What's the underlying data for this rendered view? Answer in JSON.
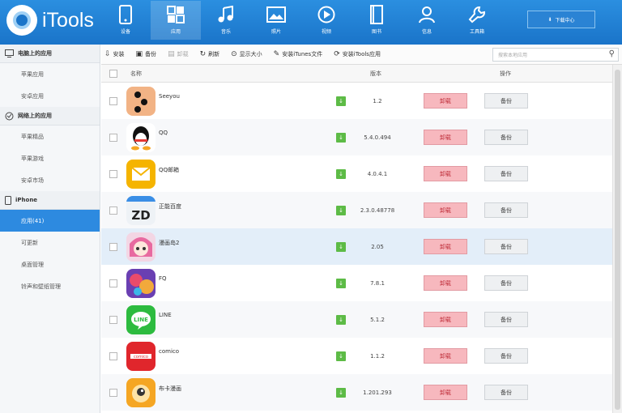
{
  "app": {
    "logo_text": "iTools",
    "brand_color": "#1a74c9"
  },
  "nav": [
    {
      "label": "设备",
      "icon": "device-icon"
    },
    {
      "label": "应用",
      "icon": "apps-icon"
    },
    {
      "label": "音乐",
      "icon": "music-icon"
    },
    {
      "label": "照片",
      "icon": "photo-icon"
    },
    {
      "label": "视频",
      "icon": "video-icon"
    },
    {
      "label": "图书",
      "icon": "book-icon"
    },
    {
      "label": "信息",
      "icon": "contacts-icon"
    },
    {
      "label": "工具箱",
      "icon": "toolbox-icon"
    }
  ],
  "download_center": "下载中心",
  "sidebar": {
    "sections": [
      {
        "title": "电脑上的应用",
        "icon": "monitor-icon",
        "items": [
          "苹果应用",
          "安卓应用"
        ]
      },
      {
        "title": "网络上的应用",
        "icon": "globe-icon",
        "items": [
          "苹果精品",
          "苹果游戏",
          "安卓市场"
        ]
      },
      {
        "title": "iPhone",
        "icon": "phone-icon",
        "items": [
          "应用(41)",
          "可更新",
          "桌面管理",
          "铃声和壁纸管理"
        ]
      }
    ]
  },
  "toolbar": {
    "items": [
      {
        "label": "安装",
        "icon": "install-icon",
        "disabled": false
      },
      {
        "label": "备份",
        "icon": "backup-icon",
        "disabled": false
      },
      {
        "label": "卸载",
        "icon": "uninstall-icon",
        "disabled": true
      },
      {
        "label": "刷新",
        "icon": "refresh-icon",
        "disabled": false
      },
      {
        "label": "显示大小",
        "icon": "size-icon",
        "disabled": false
      },
      {
        "label": "安装iTunes文件",
        "icon": "itunes-file-icon",
        "disabled": false
      },
      {
        "label": "安装iTools应用",
        "icon": "itools-app-icon",
        "disabled": false
      }
    ],
    "search_placeholder": "搜索本地应用"
  },
  "table": {
    "headers": {
      "name": "名称",
      "version": "版本",
      "action": "操作"
    },
    "uninstall_label": "卸载",
    "backup_label": "备份",
    "rows": [
      {
        "name": "Seeyou",
        "version": "1.2",
        "icon": "seeyou-app-icon"
      },
      {
        "name": "QQ",
        "version": "5.4.0.494",
        "icon": "qq-app-icon"
      },
      {
        "name": "QQ邮箱",
        "version": "4.0.4.1",
        "icon": "qq-mail-app-icon"
      },
      {
        "name": "正能百度",
        "version": "2.3.0.48778",
        "icon": "zd-app-icon"
      },
      {
        "name": "漫画岛2",
        "version": "2.05",
        "icon": "manga-app-icon"
      },
      {
        "name": "FQ",
        "version": "7.8.1",
        "icon": "fq-app-icon"
      },
      {
        "name": "LINE",
        "version": "5.1.2",
        "icon": "line-app-icon"
      },
      {
        "name": "comico",
        "version": "1.1.2",
        "icon": "comico-app-icon"
      },
      {
        "name": "布卡漫画",
        "version": "1.201.293",
        "icon": "buka-app-icon"
      }
    ]
  }
}
